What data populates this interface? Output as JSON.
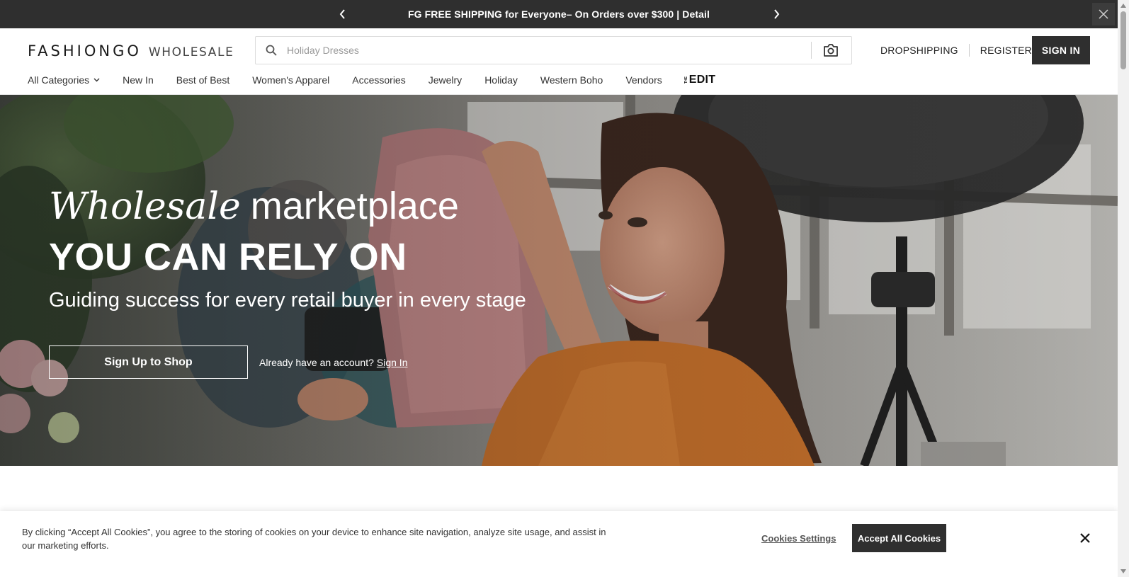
{
  "announcement": {
    "text": "FG FREE SHIPPING for Everyone– On Orders over $300 | Detail",
    "prev_icon": "chevron-left-icon",
    "next_icon": "chevron-right-icon",
    "close_icon": "close-icon"
  },
  "header": {
    "logo_main": "FASHIONGO",
    "logo_sub": "WHOLESALE",
    "search": {
      "placeholder": "Holiday Dresses",
      "value": "",
      "icon": "search-icon",
      "camera_icon": "camera-icon"
    },
    "links": {
      "dropshipping": "DROPSHIPPING",
      "register": "REGISTER",
      "sign_in": "SIGN IN"
    },
    "nav": {
      "all_categories": "All Categories",
      "items": [
        "New In",
        "Best of Best",
        "Women's Apparel",
        "Accessories",
        "Jewelry",
        "Holiday",
        "Western Boho",
        "Vendors"
      ],
      "edit_small": "THE",
      "edit_big": "EDIT"
    }
  },
  "hero": {
    "italic": "Wholesale",
    "light": "marketplace",
    "title": "YOU CAN RELY ON",
    "subtitle": "Guiding success for every retail buyer in every stage",
    "cta_label": "Sign Up to Shop",
    "have_account": "Already have an account?",
    "sign_in_link": "Sign In"
  },
  "cookie": {
    "text": "By clicking “Accept All Cookies”, you agree to the storing of cookies on your device to enhance site navigation, analyze site usage, and assist in our marketing efforts.",
    "settings_label": "Cookies Settings",
    "accept_label": "Accept All Cookies",
    "close_icon": "close-icon"
  },
  "colors": {
    "dark": "#2f2f2f",
    "white": "#ffffff",
    "shirt_orange": "#c7702a"
  }
}
